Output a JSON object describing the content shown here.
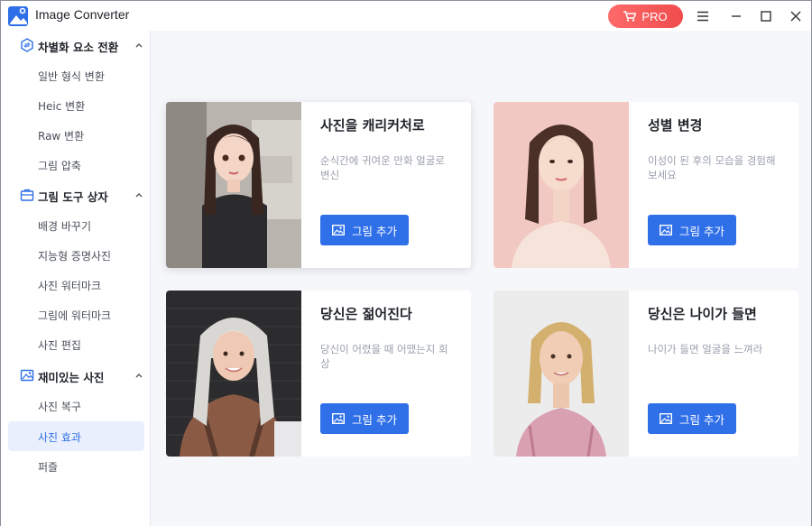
{
  "app": {
    "title": "Image Converter",
    "pro_label": "PRO",
    "accent": "#2f6fe8",
    "pro_color": "#f04c4c"
  },
  "sidebar": {
    "groups": [
      {
        "label": "차별화 요소 전환",
        "icon": "convert-icon",
        "items": [
          "일반 형식 변환",
          "Heic 변환",
          "Raw 변환",
          "그림 압축"
        ]
      },
      {
        "label": "그림 도구 상자",
        "icon": "toolbox-icon",
        "items": [
          "배경 바꾸기",
          "지능형 증명사진",
          "사진 워터마크",
          "그림에 워터마크",
          "사진 편집"
        ]
      },
      {
        "label": "재미있는 사진",
        "icon": "fun-image-icon",
        "items": [
          "사진 복구",
          "사진 효과",
          "퍼즐"
        ]
      }
    ],
    "active_item": "사진 효과"
  },
  "cards": [
    {
      "title": "사진을 캐리커처로",
      "desc": "순식간에 귀여운 만화 얼굴로 변신",
      "button": "그림 추가"
    },
    {
      "title": "성별 변경",
      "desc": "이성이 된 후의 모습을 경험해보세요",
      "button": "그림 추가"
    },
    {
      "title": "당신은 젊어진다",
      "desc": "당신이 어렸을 때 어땠는지 회상",
      "button": "그림 추가"
    },
    {
      "title": "당신은 나이가 들면",
      "desc": "나이가 들면 얼굴을 느껴라",
      "button": "그림 추가"
    }
  ]
}
